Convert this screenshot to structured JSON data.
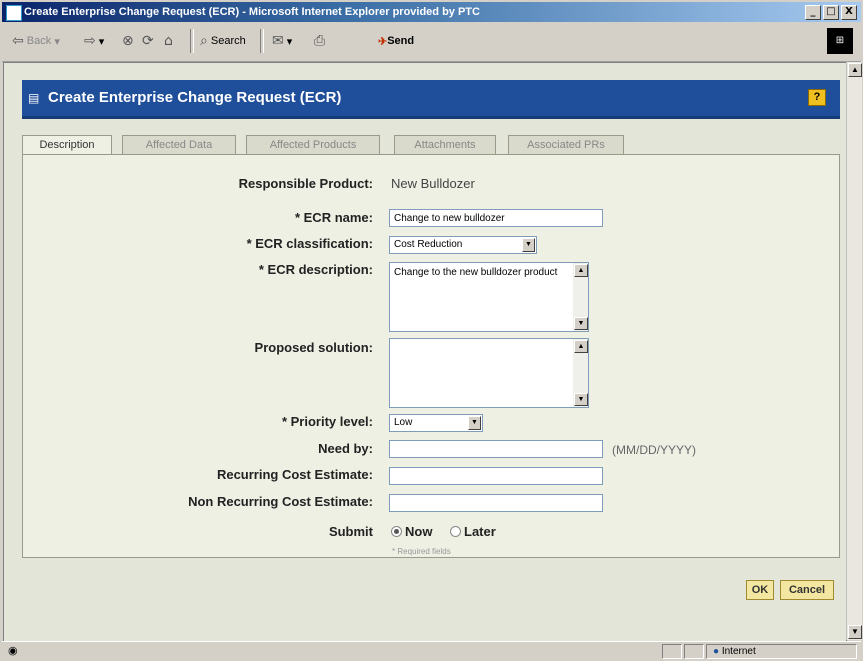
{
  "window": {
    "title": "Create Enterprise Change Request (ECR) - Microsoft Internet Explorer provided by PTC",
    "buttons": {
      "minimize": "_",
      "maximize": "□",
      "close": "X"
    }
  },
  "toolbar": {
    "back": "Back",
    "search": "Search",
    "send": "Send"
  },
  "banner": {
    "title": "Create Enterprise Change Request (ECR)",
    "help": "?"
  },
  "tabs": [
    "Description",
    "Affected Data",
    "Affected Products",
    "Attachments",
    "Associated PRs"
  ],
  "form": {
    "responsible_product": {
      "label": "Responsible Product:",
      "value": "New Bulldozer"
    },
    "ecr_name": {
      "label": "* ECR name:",
      "value": "Change to new bulldozer"
    },
    "ecr_classification": {
      "label": "* ECR classification:",
      "value": "Cost Reduction"
    },
    "ecr_description": {
      "label": "* ECR description:",
      "value": "Change to the new bulldozer product"
    },
    "proposed_solution": {
      "label": "Proposed solution:",
      "value": ""
    },
    "priority_level": {
      "label": "* Priority level:",
      "value": "Low"
    },
    "need_by": {
      "label": "Need by:",
      "value": "",
      "hint": "(MM/DD/YYYY)"
    },
    "recurring_cost": {
      "label": "Recurring Cost Estimate:",
      "value": ""
    },
    "non_recurring_cost": {
      "label": "Non Recurring Cost Estimate:",
      "value": ""
    },
    "submit": {
      "label": "Submit",
      "now": "Now",
      "later": "Later",
      "selected": "Now"
    },
    "required_note": "* Required fields"
  },
  "actions": {
    "ok": "OK",
    "cancel": "Cancel"
  },
  "status": {
    "zone": "Internet"
  }
}
